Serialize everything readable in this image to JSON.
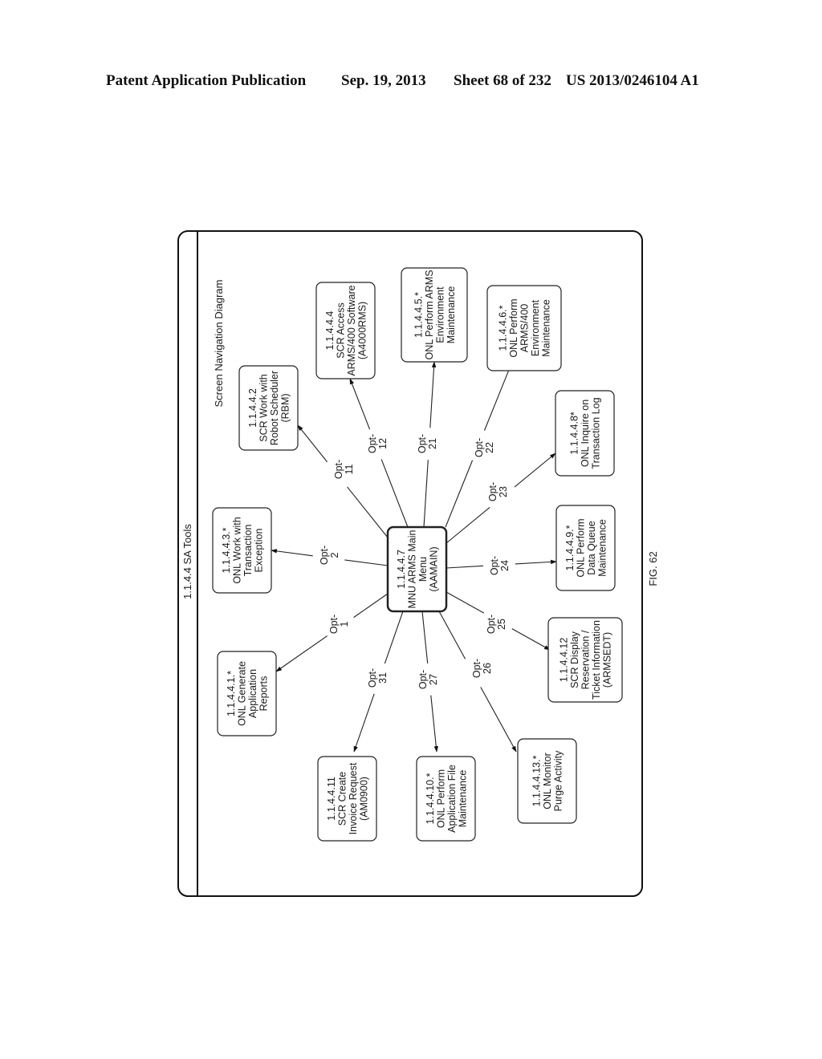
{
  "header": {
    "publication": "Patent Application Publication",
    "date": "Sep. 19, 2013",
    "sheet": "Sheet 68 of 232",
    "patent_number": "US 2013/0246104 A1"
  },
  "diagram": {
    "frame_title": "1.1.4.4 SA Tools",
    "subtitle": "Screen Navigation Diagram",
    "figure_label": "FIG. 62",
    "center": {
      "id": "1.1.4.4.7",
      "lines": [
        "1.1.4.4.7",
        "MNU ARMS Main",
        "Menu",
        "(AAMAIN)"
      ]
    },
    "nodes": [
      {
        "id": "1.1.4.4.2",
        "lines": [
          "1.1.4.4.2",
          "SCR Work with",
          "Robot Scheduler",
          "(RBM)"
        ],
        "option": "Opt- 11"
      },
      {
        "id": "1.1.4.4.3",
        "lines": [
          "1.1.4.4.3.*",
          "ONL Work with",
          "Transaction",
          "Exception"
        ],
        "option": "Opt- 2"
      },
      {
        "id": "1.1.4.4.1",
        "lines": [
          "1.1.4.4.1.*",
          "ONL Generate",
          "Application",
          "Reports"
        ],
        "option": "Opt- 1"
      },
      {
        "id": "1.1.4.4.11",
        "lines": [
          "1.1.4.4.11",
          "SCR Create",
          "Invoice Request",
          "(AM0900)"
        ],
        "option": "Opt- 31"
      },
      {
        "id": "1.1.4.4.10",
        "lines": [
          "1.1.4.4.10.*",
          "ONL Perform",
          "Application File",
          "Maintenance"
        ],
        "option": "Opt- 27"
      },
      {
        "id": "1.1.4.4.13",
        "lines": [
          "1.1.4.4.13.*",
          "ONL Monitor",
          "Purge Activity"
        ],
        "option": "Opt- 26"
      },
      {
        "id": "1.1.4.4.12",
        "lines": [
          "1.1.4.4.12",
          "SCR Display",
          "Reservation /",
          "Ticket Information",
          "(ARMSEDT)"
        ],
        "option": "Opt- 25"
      },
      {
        "id": "1.1.4.4.9",
        "lines": [
          "1.1.4.4.9.*",
          "ONL Perform",
          "Data Queue",
          "Maintenance"
        ],
        "option": "Opt- 24"
      },
      {
        "id": "1.1.4.4.8",
        "lines": [
          "1.1.4.4.8*",
          "ONL Inquire on",
          "Transaction Log"
        ],
        "option": "Opt- 23"
      },
      {
        "id": "1.1.4.4.6",
        "lines": [
          "1.1.4.4.6.*",
          "ONL Perform",
          "ARMS/400",
          "Environment",
          "Maintenance"
        ],
        "option": "Opt- 22"
      },
      {
        "id": "1.1.4.4.5",
        "lines": [
          "1.1.4.4.5.*",
          "ONL Perform ARMS",
          "Environment",
          "Maintenance"
        ],
        "option": "Opt- 21"
      },
      {
        "id": "1.1.4.4.4",
        "lines": [
          "1.1.4.4.4",
          "SCR Access",
          "ARMS/400 Software",
          "(A4000RMS)"
        ],
        "option": "Opt- 12"
      }
    ]
  }
}
